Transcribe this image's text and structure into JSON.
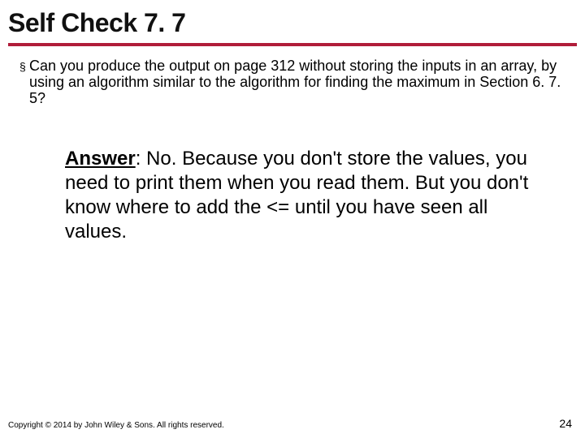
{
  "title": "Self Check 7. 7",
  "bullet": {
    "marker": "§",
    "text": "Can you produce the output on page 312 without storing the inputs in an array, by using an algorithm similar to the algorithm for finding the maximum in Section 6. 7. 5?"
  },
  "answer": {
    "label": "Answer",
    "separator": ": ",
    "text": "No. Because you don't store the values, you need to print them when you read them. But you don't know where to add the <= until you have seen all values."
  },
  "footer": {
    "copyright": "Copyright © 2014 by John Wiley & Sons. All rights reserved.",
    "page": "24"
  }
}
